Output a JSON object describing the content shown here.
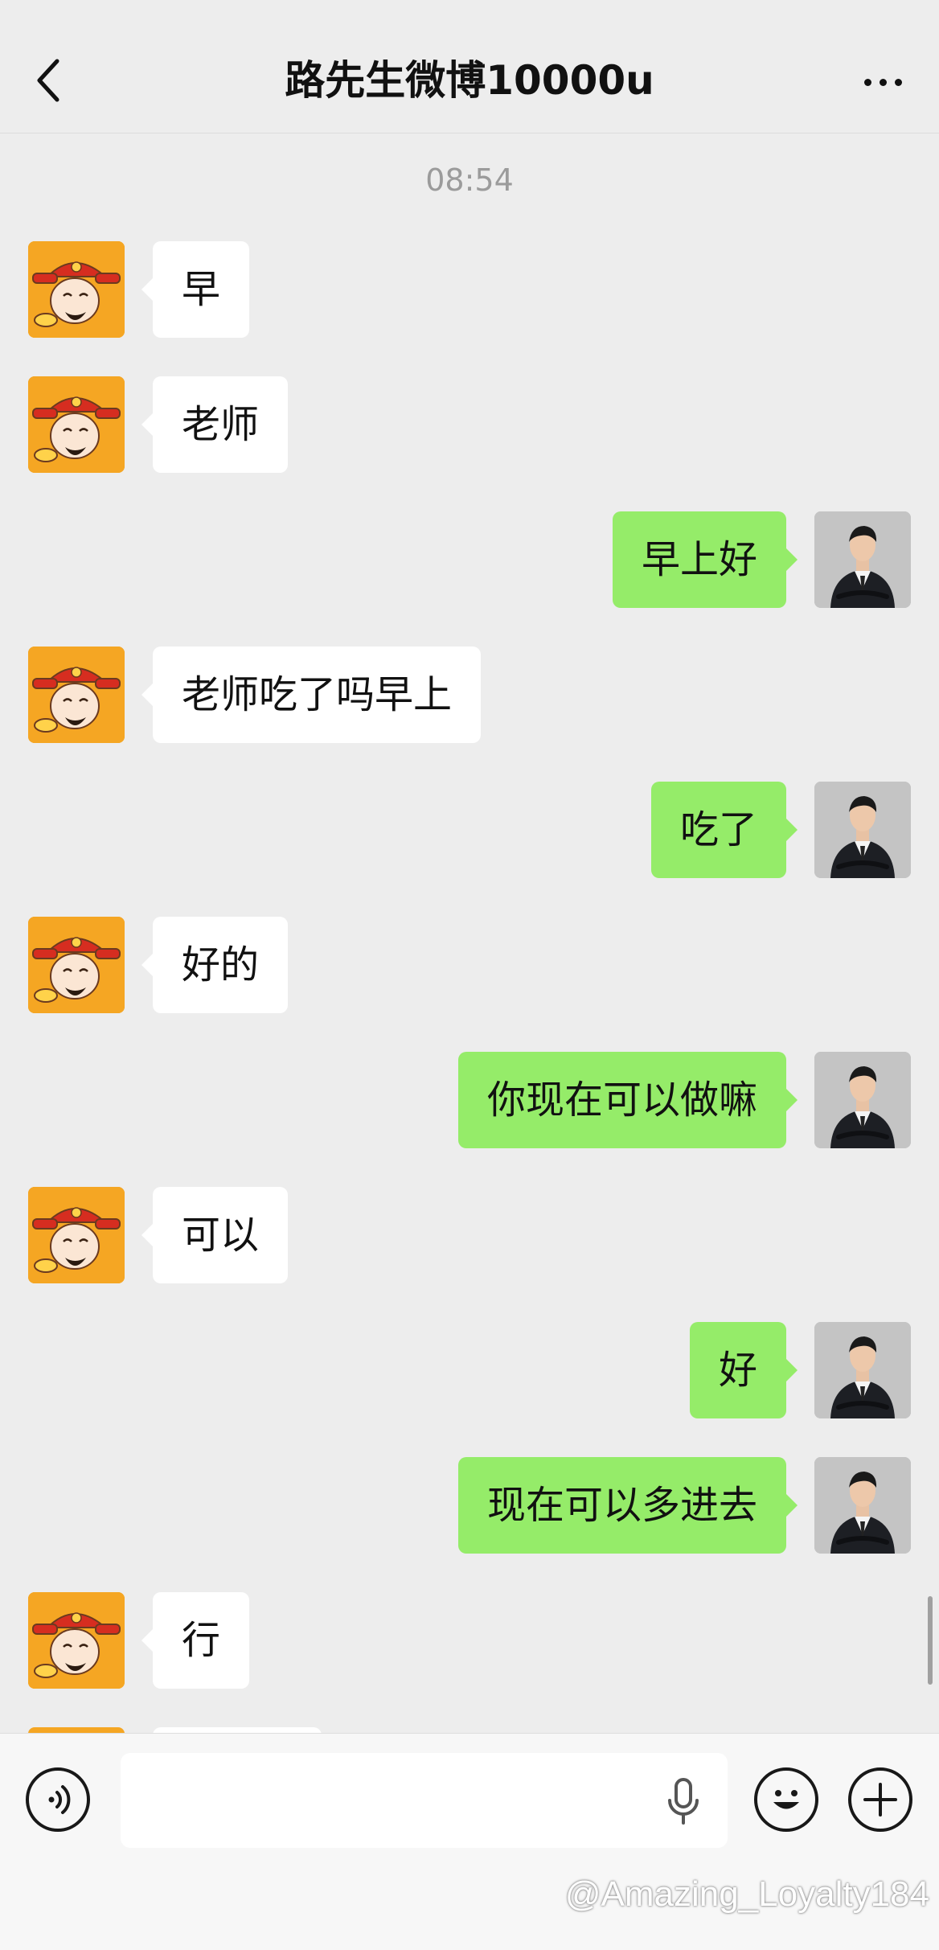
{
  "header": {
    "title": "路先生微博10000u"
  },
  "timestamp": "08:54",
  "messages": [
    {
      "side": "left",
      "text": "早"
    },
    {
      "side": "left",
      "text": "老师"
    },
    {
      "side": "right",
      "text": "早上好"
    },
    {
      "side": "left",
      "text": "老师吃了吗早上"
    },
    {
      "side": "right",
      "text": "吃了"
    },
    {
      "side": "left",
      "text": "好的"
    },
    {
      "side": "right",
      "text": "你现在可以做嘛"
    },
    {
      "side": "left",
      "text": "可以"
    },
    {
      "side": "right",
      "text": "好"
    },
    {
      "side": "right",
      "text": "现在可以多进去"
    },
    {
      "side": "left",
      "text": "行"
    }
  ],
  "input": {
    "value": ""
  },
  "watermark": "@Amazing_Loyalty184",
  "icons": {
    "back": "chevron-left-icon",
    "more": "more-dots-icon",
    "voice": "voice-icon",
    "mic": "microphone-icon",
    "emoji": "emoji-icon",
    "plus": "plus-icon"
  },
  "colors": {
    "background": "#ededed",
    "outgoing_bubble": "#95ec69",
    "incoming_bubble": "#ffffff",
    "fortune_avatar": "#f5a623"
  }
}
